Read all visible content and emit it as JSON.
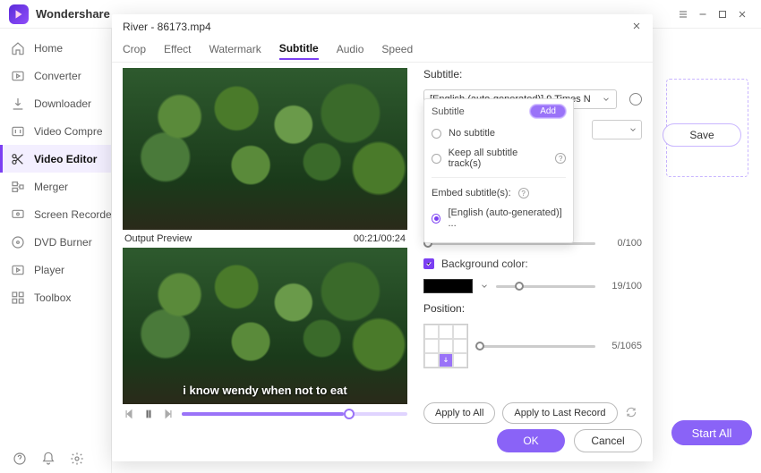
{
  "header": {
    "app_title": "Wondershare "
  },
  "sidebar": {
    "items": [
      {
        "label": "Home"
      },
      {
        "label": "Converter"
      },
      {
        "label": "Downloader"
      },
      {
        "label": "Video Compre"
      },
      {
        "label": "Video Editor"
      },
      {
        "label": "Merger"
      },
      {
        "label": "Screen Recorde"
      },
      {
        "label": "DVD Burner"
      },
      {
        "label": "Player"
      },
      {
        "label": "Toolbox"
      }
    ]
  },
  "right_panel": {
    "save_label": "Save",
    "start_all_label": "Start All"
  },
  "modal": {
    "title": "River - 86173.mp4",
    "tabs": [
      "Crop",
      "Effect",
      "Watermark",
      "Subtitle",
      "Audio",
      "Speed"
    ],
    "active_tab": 3,
    "preview": {
      "output_label": "Output Preview",
      "time": "00:21/00:24",
      "subtitle_text": "i know wendy when not to eat"
    },
    "settings": {
      "subtitle_label": "Subtitle:",
      "subtitle_select": "[English (auto-generated)] 9 Times N",
      "transparency_value": "0/100",
      "bg_label": "Background color:",
      "bg_value": "19/100",
      "position_label": "Position:",
      "position_value": "5/1065"
    },
    "popup": {
      "title": "Subtitle",
      "add_label": "Add",
      "no_subtitle": "No subtitle",
      "keep_all": "Keep all subtitle track(s)",
      "embed_label": "Embed subtitle(s):",
      "embed_option": "[English (auto-generated)] ..."
    },
    "footer": {
      "apply_all": "Apply to All",
      "apply_last": "Apply to Last Record",
      "ok": "OK",
      "cancel": "Cancel"
    }
  }
}
